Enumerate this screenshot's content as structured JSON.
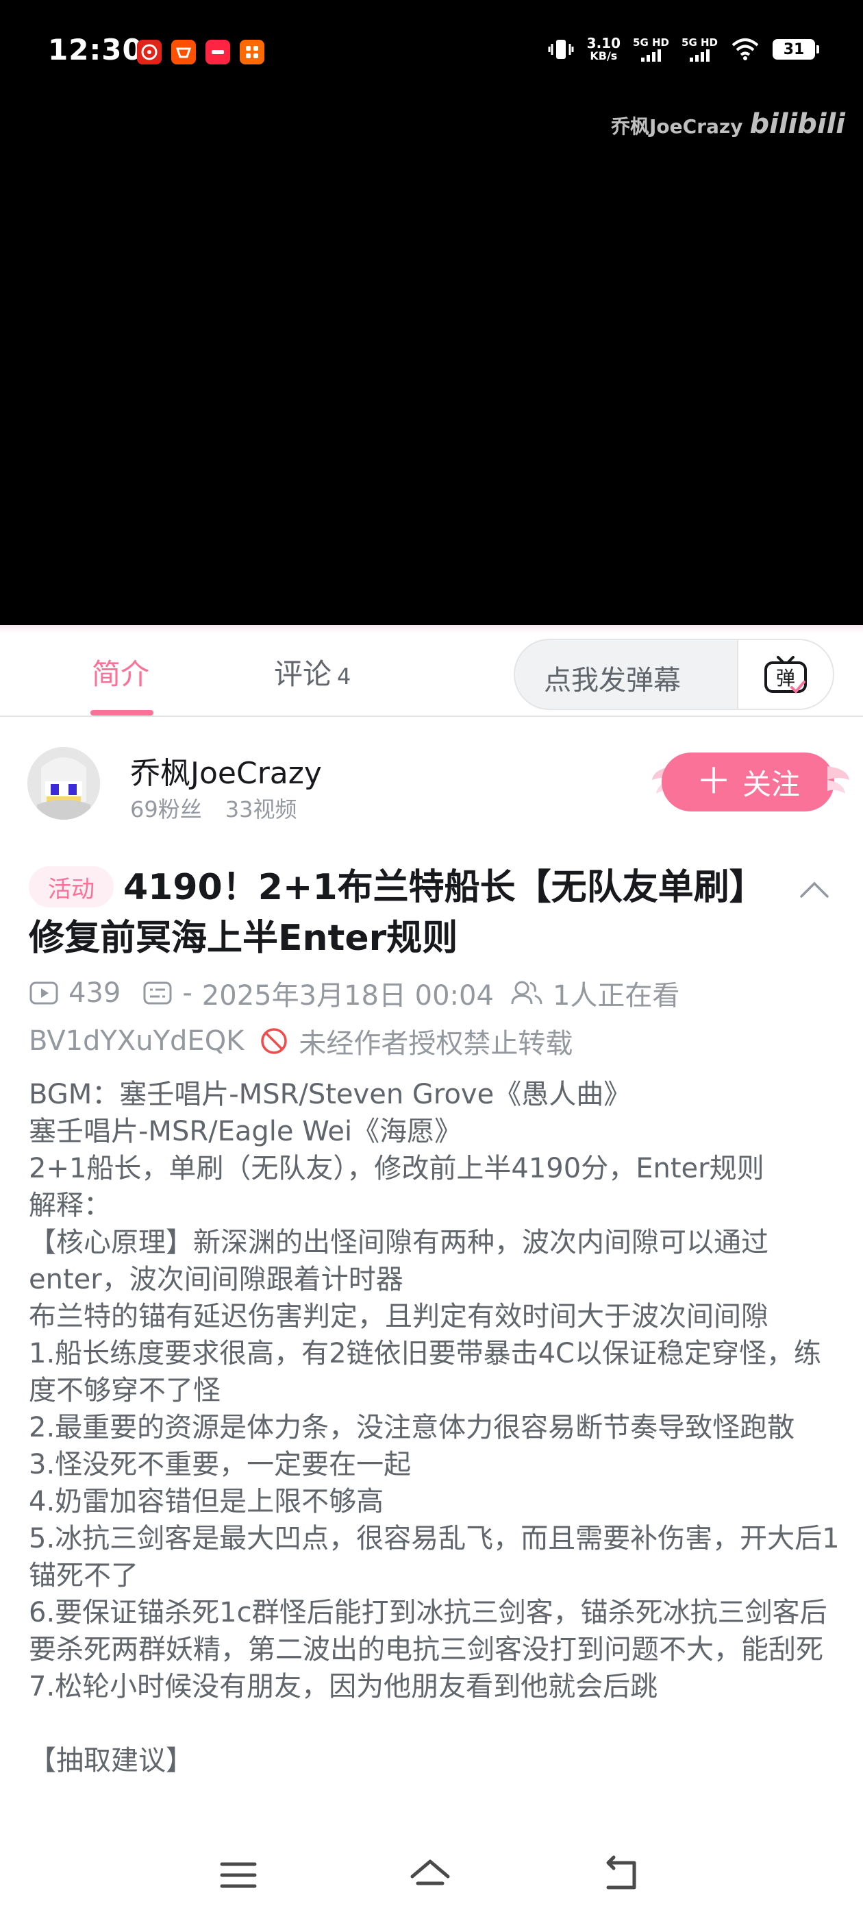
{
  "status_bar": {
    "time": "12:30",
    "net_speed_value": "3.10",
    "net_speed_unit": "KB/s",
    "sim1": "5G HD",
    "sim2": "5G HD",
    "battery": "31",
    "app_icons": [
      "netease-music-icon",
      "taobao-icon",
      "xiaohongshu-icon",
      "meituan-icon"
    ]
  },
  "video": {
    "watermark_name": "乔枫JoeCrazy",
    "watermark_logo": "bilibili"
  },
  "tabs": {
    "intro": "简介",
    "comments": "评论",
    "comments_count": "4",
    "danmaku_placeholder": "点我发弹幕",
    "danmaku_icon_text": "弹"
  },
  "uploader": {
    "name": "乔枫JoeCrazy",
    "fans": "69粉丝",
    "videos": "33视频",
    "follow_label": "关注"
  },
  "video_info": {
    "badge": "活动",
    "title": "4190！2+1布兰特船长【无队友单刷】修复前冥海上半Enter规则",
    "views": "439",
    "danmaku_count": "-",
    "date": "2025年3月18日 00:04",
    "watching": "1人正在看",
    "bvid": "BV1dYXuYdEQK",
    "copyright": "未经作者授权禁止转载"
  },
  "description": [
    "BGM：塞壬唱片-MSR/Steven Grove《愚人曲》",
    "塞壬唱片-MSR/Eagle Wei《海愿》",
    "2+1船长，单刷（无队友），修改前上半4190分，Enter规则",
    "解释：",
    "【核心原理】新深渊的出怪间隙有两种，波次内间隙可以通过enter，波次间间隙跟着计时器",
    "布兰特的锚有延迟伤害判定，且判定有效时间大于波次间间隙",
    "1.船长练度要求很高，有2链依旧要带暴击4C以保证稳定穿怪，练度不够穿不了怪",
    "2.最重要的资源是体力条，没注意体力很容易断节奏导致怪跑散",
    "3.怪没死不重要，一定要在一起",
    "4.奶雷加容错但是上限不够高",
    "5.冰抗三剑客是最大凹点，很容易乱飞，而且需要补伤害，开大后1锚死不了",
    "6.要保证锚杀死1c群怪后能打到冰抗三剑客，锚杀死冰抗三剑客后要杀死两群妖精，第二波出的电抗三剑客没打到问题不大，能刮死",
    "7.松轮小时候没有朋友，因为他朋友看到他就会后跳",
    "",
    "【抽取建议】"
  ],
  "colors": {
    "accent": "#fb7299",
    "text_primary": "#18191c",
    "text_secondary": "#61666d",
    "text_muted": "#9499a0"
  }
}
